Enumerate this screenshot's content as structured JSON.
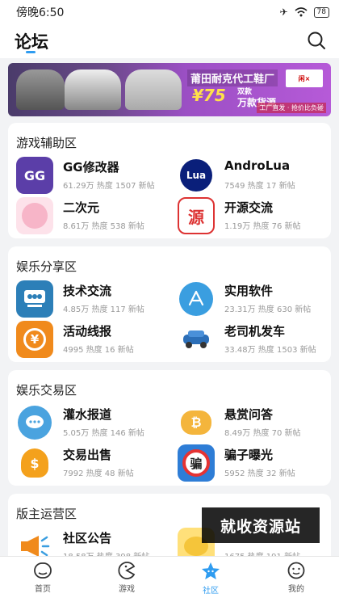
{
  "status_bar": {
    "time": "傍晚6:50",
    "battery": "78"
  },
  "header": {
    "title": "论坛"
  },
  "banner": {
    "title": "莆田耐克代工鞋厂",
    "price": "¥75",
    "price_sub_top": "双款",
    "price_sub": "万款货源",
    "footer": "工厂直发 · 抢价比负碰",
    "logo_text": "闲×"
  },
  "sections": [
    {
      "title": "游戏辅助区",
      "items": [
        {
          "name": "GG修改器",
          "stats": "61.29万 热度  1507 新帖",
          "icon": "gg-modifier-icon"
        },
        {
          "name": "AndroLua",
          "stats": "7549 热度  17 新帖",
          "icon": "lua-icon"
        },
        {
          "name": "二次元",
          "stats": "8.61万 热度  538 新帖",
          "icon": "anime-girl-icon"
        },
        {
          "name": "开源交流",
          "stats": "1.19万 热度  76 新帖",
          "icon": "open-source-icon"
        }
      ]
    },
    {
      "title": "娱乐分享区",
      "items": [
        {
          "name": "技术交流",
          "stats": "4.85万 热度  117 新帖",
          "icon": "people-icon"
        },
        {
          "name": "实用软件",
          "stats": "23.31万 热度  630 新帖",
          "icon": "app-store-icon"
        },
        {
          "name": "活动线报",
          "stats": "4995 热度  16 新帖",
          "icon": "yen-coin-icon"
        },
        {
          "name": "老司机发车",
          "stats": "33.48万 热度  1503 新帖",
          "icon": "car-icon"
        }
      ]
    },
    {
      "title": "娱乐交易区",
      "items": [
        {
          "name": "灌水报道",
          "stats": "5.05万 热度  146 新帖",
          "icon": "chat-bubble-icon"
        },
        {
          "name": "悬赏问答",
          "stats": "8.49万 热度  70 新帖",
          "icon": "bitcoin-chat-icon"
        },
        {
          "name": "交易出售",
          "stats": "7992 热度  48 新帖",
          "icon": "money-bag-icon"
        },
        {
          "name": "骗子曝光",
          "stats": "5952 热度  32 新帖",
          "icon": "scam-warning-icon"
        }
      ]
    },
    {
      "title": "版主运营区",
      "items": [
        {
          "name": "社区公告",
          "stats": "18.58万 热度  398 新帖",
          "icon": "megaphone-icon"
        },
        {
          "name": "",
          "stats": "1675 热度  191 新帖",
          "icon": "cartoon-icon"
        }
      ]
    }
  ],
  "watermark": "就收资源站",
  "tabbar": [
    {
      "label": "首页",
      "icon": "home-face-icon"
    },
    {
      "label": "游戏",
      "icon": "game-pacman-icon"
    },
    {
      "label": "社区",
      "icon": "community-star-icon",
      "active": true
    },
    {
      "label": "我的",
      "icon": "profile-face-icon"
    }
  ],
  "colors": {
    "accent": "#2f9cf0",
    "background": "#f2f3f5"
  }
}
